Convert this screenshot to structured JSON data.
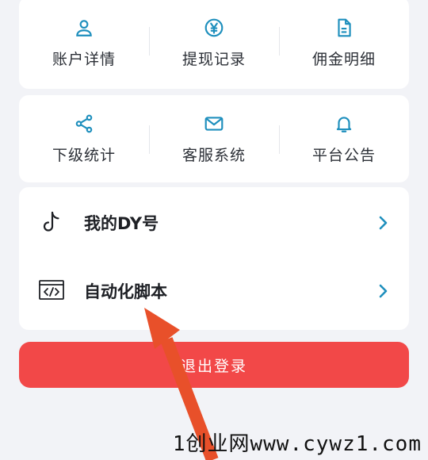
{
  "grid_top": [
    {
      "label": "账户详情",
      "icon": "user-icon"
    },
    {
      "label": "提现记录",
      "icon": "yen-coin-icon"
    },
    {
      "label": "佣金明细",
      "icon": "document-icon"
    }
  ],
  "grid_bottom": [
    {
      "label": "下级统计",
      "icon": "share-icon"
    },
    {
      "label": "客服系统",
      "icon": "mail-icon"
    },
    {
      "label": "平台公告",
      "icon": "bell-icon"
    }
  ],
  "list": [
    {
      "label": "我的DY号",
      "icon": "tiktok-icon"
    },
    {
      "label": "自动化脚本",
      "icon": "code-window-icon"
    }
  ],
  "logout_label": "退出登录",
  "watermark": "1创业网www.cywz1.com",
  "colors": {
    "accent": "#1e8fbd",
    "danger": "#f24848",
    "arrow": "#e8502a"
  }
}
